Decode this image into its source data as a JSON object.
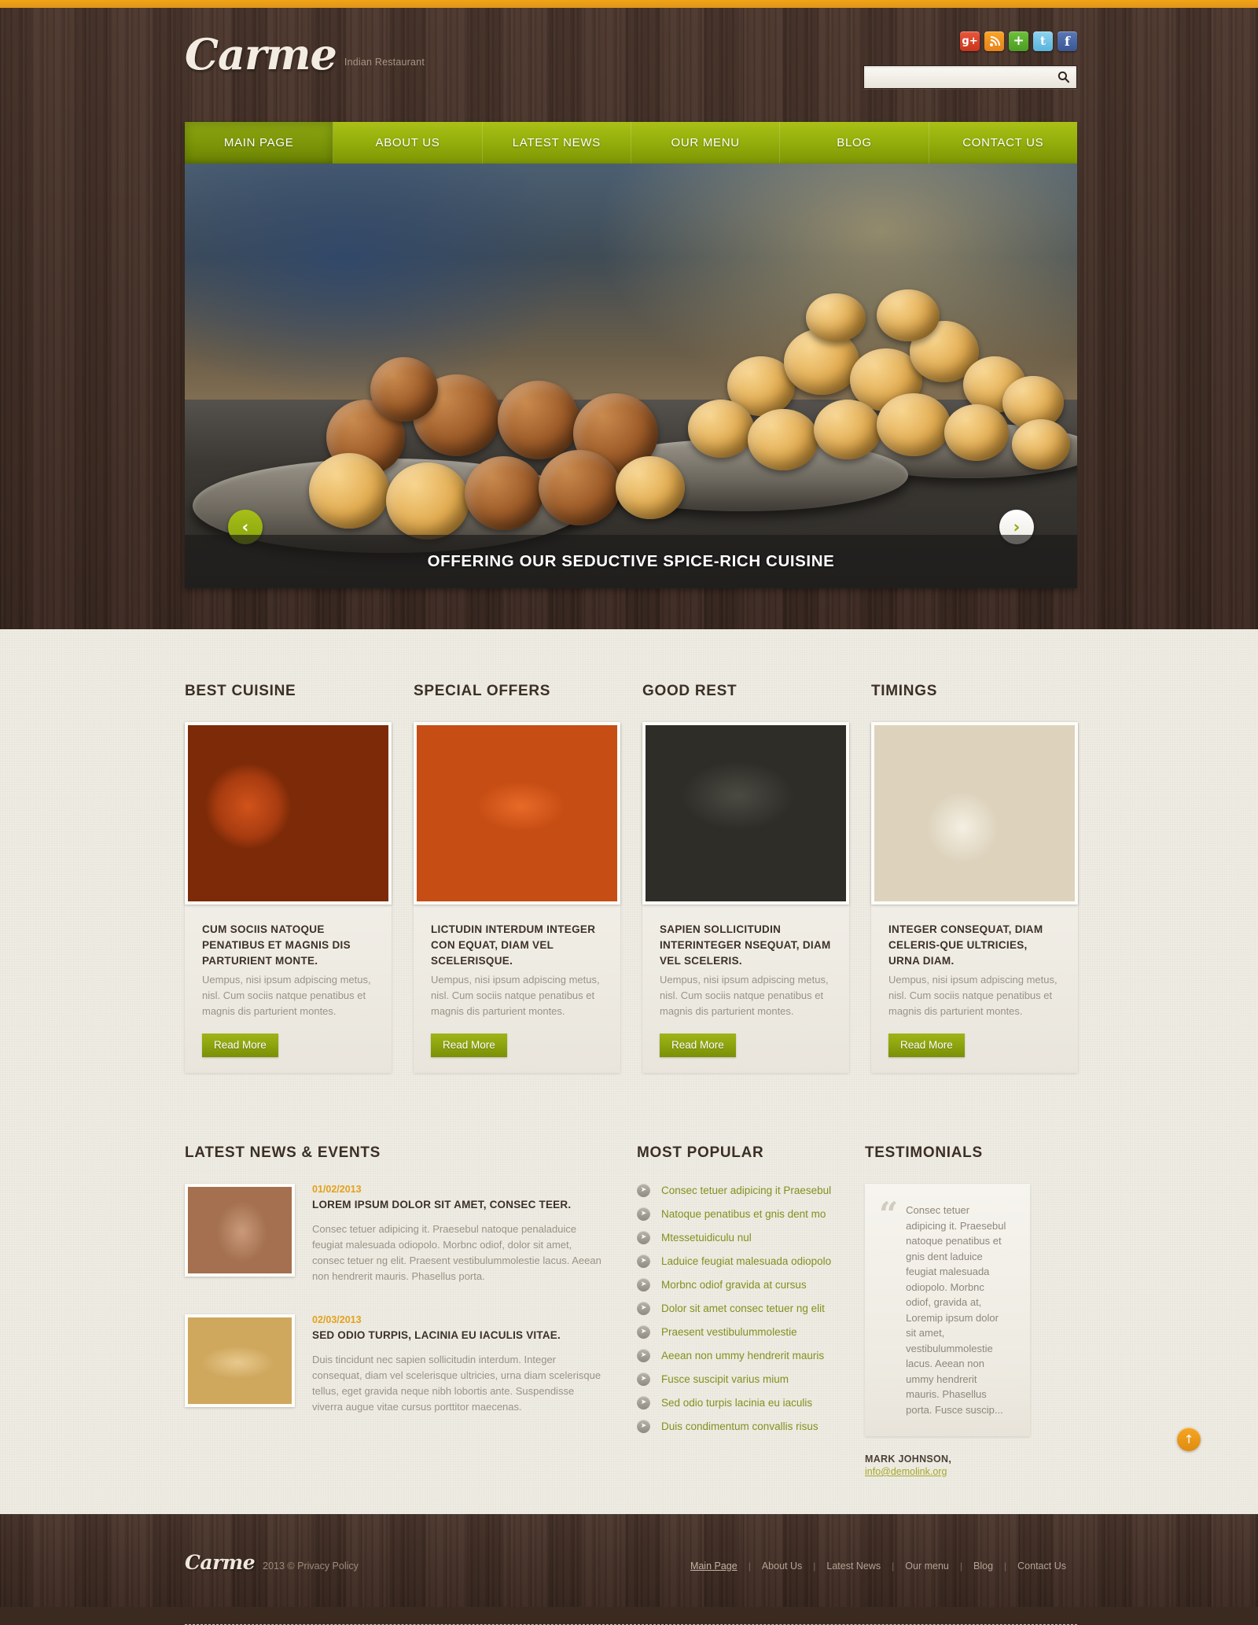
{
  "brand": {
    "name": "Carme",
    "tagline": "Indian Restaurant"
  },
  "colors": {
    "accent_green": "#8da40f",
    "nav_green": "#96b00c",
    "wood_brown": "#42302a",
    "orange": "#e3a21c",
    "page_bg": "#efece3",
    "link_olive": "#83901f"
  },
  "social": [
    {
      "name": "google-plus",
      "glyph": "g+"
    },
    {
      "name": "rss",
      "glyph": "◤"
    },
    {
      "name": "addthis",
      "glyph": "+"
    },
    {
      "name": "twitter",
      "glyph": "t"
    },
    {
      "name": "facebook",
      "glyph": "f"
    }
  ],
  "search": {
    "value": "",
    "placeholder": "",
    "icon": "search-icon"
  },
  "nav": [
    {
      "label": "MAIN PAGE",
      "active": true
    },
    {
      "label": "ABOUT US",
      "active": false
    },
    {
      "label": "LATEST NEWS",
      "active": false
    },
    {
      "label": "OUR MENU",
      "active": false
    },
    {
      "label": "BLOG",
      "active": false
    },
    {
      "label": "CONTACT US",
      "active": false
    }
  ],
  "slider": {
    "caption": "OFFERING OUR SEDUCTIVE SPICE-RICH CUISINE",
    "prev_icon": "‹",
    "next_icon": "›"
  },
  "features": [
    {
      "heading": "BEST CUISINE",
      "title": "CUM SOCIIS NATOQUE PENATIBUS ET MAGNIS DIS PARTURIENT MONTE.",
      "text": "Uempus, nisi ipsum adpiscing metus, nisl. Cum sociis natque penatibus et magnis dis parturient montes.",
      "button": "Read More"
    },
    {
      "heading": "SPECIAL OFFERS",
      "title": "LICTUDIN INTERDUM INTEGER CON EQUAT, DIAM VEL SCELERISQUE.",
      "text": "Uempus, nisi ipsum adpiscing metus, nisl. Cum sociis natque penatibus et magnis dis parturient montes.",
      "button": "Read More"
    },
    {
      "heading": "GOOD REST",
      "title": "SAPIEN SOLLICITUDIN INTERINTEGER NSEQUAT, DIAM VEL SCELERIS.",
      "text": "Uempus, nisi ipsum adpiscing metus, nisl. Cum sociis natque penatibus et magnis dis parturient montes.",
      "button": "Read More"
    },
    {
      "heading": "TIMINGS",
      "title": "INTEGER CONSEQUAT, DIAM CELERIS-QUE ULTRICIES, URNA DIAM.",
      "text": "Uempus, nisi ipsum adpiscing metus, nisl. Cum sociis natque penatibus et magnis dis parturient montes.",
      "button": "Read More"
    }
  ],
  "news": {
    "heading": "LATEST NEWS & EVENTS",
    "items": [
      {
        "date": "01/02/2013",
        "title": "LOREM IPSUM DOLOR SIT AMET, CONSEC TEER.",
        "text": "Consec tetuer adipicing it. Praesebul natoque penaladuice feugiat  malesuada odiopolo. Morbnc odiof,  dolor sit amet, consec tetuer ng elit. Praesent vestibulummolestie lacus. Aeean non hendrerit mauris. Phasellus porta."
      },
      {
        "date": "02/03/2013",
        "title": "SED ODIO TURPIS, LACINIA EU IACULIS VITAE.",
        "text": "Duis tincidunt nec sapien sollicitudin interdum. Integer consequat, diam vel scelerisque ultricies, urna diam scelerisque tellus, eget gravida neque nibh lobortis ante. Suspendisse viverra augue vitae cursus porttitor maecenas."
      }
    ]
  },
  "popular": {
    "heading": "MOST POPULAR",
    "items": [
      "Consec tetuer adipicing it Praesebul",
      "Natoque penatibus et gnis dent mo",
      "Mtessetuidiculu nul",
      "Laduice feugiat  malesuada odiopolo",
      "Morbnc odiof  gravida at cursus",
      "Dolor sit amet consec tetuer ng elit",
      "Praesent vestibulummolestie",
      "Aeean non ummy hendrerit mauris",
      "Fusce suscipit varius mium",
      "Sed odio turpis lacinia eu iaculis",
      "Duis condimentum convallis risus"
    ]
  },
  "testimonials": {
    "heading": "TESTIMONIALS",
    "quote_mark": "“",
    "text": "Consec tetuer adipicing it. Praesebul natoque penatibus et gnis dent laduice feugiat  malesuada odiopolo. Morbnc odiof,  gravida at, Loremip ipsum dolor sit amet, vestibulummolestie lacus. Aeean non ummy hendrerit mauris. Phasellus porta. Fusce suscip...",
    "author": "MARK JOHNSON,",
    "email": "info@demolink.org"
  },
  "to_top": {
    "name": "scroll-to-top",
    "icon": "↑"
  },
  "footer": {
    "logo": "Carme",
    "copyright": "2013 © Privacy Policy",
    "links": [
      {
        "label": "Main Page",
        "current": true
      },
      {
        "label": "About Us",
        "current": false
      },
      {
        "label": "Latest News",
        "current": false
      },
      {
        "label": "Our menu",
        "current": false
      },
      {
        "label": "Blog",
        "current": false
      },
      {
        "label": "Contact Us",
        "current": false
      }
    ],
    "separator": "|"
  }
}
